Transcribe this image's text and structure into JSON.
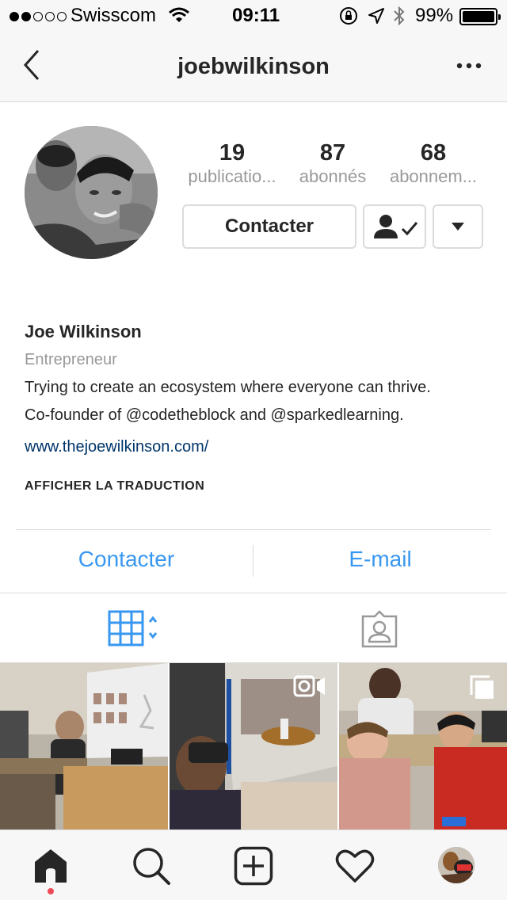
{
  "status_bar": {
    "carrier": "Swisscom",
    "time": "09:11",
    "battery": "99%"
  },
  "nav": {
    "title": "joebwilkinson"
  },
  "profile": {
    "stats": [
      {
        "value": "19",
        "label": "publicatio..."
      },
      {
        "value": "87",
        "label": "abonnés"
      },
      {
        "value": "68",
        "label": "abonnem..."
      }
    ],
    "contact_button": "Contacter",
    "name": "Joe Wilkinson",
    "category": "Entrepreneur",
    "bio_lines": [
      "Trying to create an ecosystem where everyone can thrive.",
      "Co-founder of @codetheblock and @sparkedlearning."
    ],
    "website": "www.thejoewilkinson.com/",
    "translate_label": "AFFICHER LA TRADUCTION"
  },
  "actions": {
    "contact": "Contacter",
    "email": "E-mail"
  },
  "colors": {
    "accent": "#3897f0",
    "link": "#003569",
    "notification_dot": "#ed4956"
  }
}
